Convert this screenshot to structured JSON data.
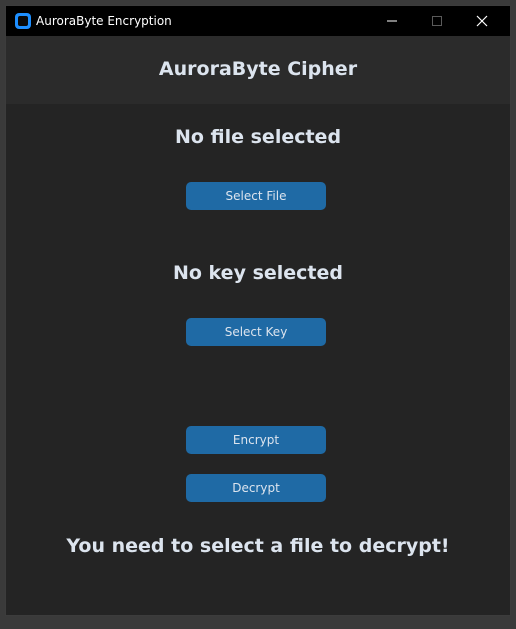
{
  "window": {
    "title": "AuroraByte Encryption"
  },
  "header": {
    "title": "AuroraByte Cipher"
  },
  "file": {
    "status": "No file selected",
    "button_label": "Select File"
  },
  "key": {
    "status": "No key selected",
    "button_label": "Select Key"
  },
  "actions": {
    "encrypt_label": "Encrypt",
    "decrypt_label": "Decrypt"
  },
  "message": {
    "text": "You need to select a file to decrypt!"
  },
  "colors": {
    "accent_button": "#1f6aa5",
    "background": "#242424",
    "header_bg": "#2b2b2b",
    "text": "#dce4ee",
    "titlebar_bg": "#000000"
  },
  "icons": {
    "app": "app-icon",
    "minimize": "minimize-icon",
    "maximize": "maximize-icon",
    "close": "close-icon"
  }
}
